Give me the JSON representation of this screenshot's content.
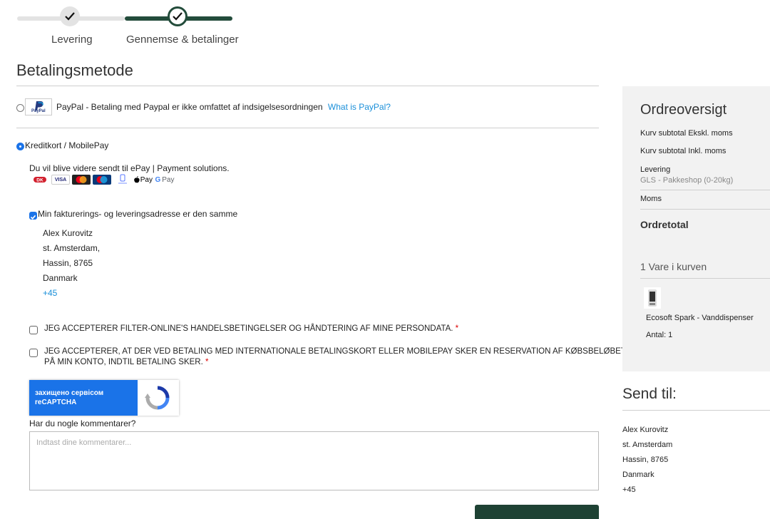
{
  "steps": [
    {
      "label": "Levering",
      "done": true
    },
    {
      "label": "Gennemse & betalinger",
      "done": true,
      "active": true
    }
  ],
  "colors": {
    "accent": "#234c3b",
    "link": "#1a8fd9",
    "checkbox": "#1a73e8"
  },
  "payment": {
    "title": "Betalingsmetode",
    "paypal": {
      "label": "PayPal - Betaling med Paypal er ikke omfattet af indsigelsesordningen",
      "link": "What is PayPal?",
      "logo_text": "PayPal",
      "selected": false
    },
    "card": {
      "label": "Kreditkort / MobilePay",
      "selected": true,
      "info": "Du vil blive videre sendt til ePay | Payment solutions.",
      "icons": [
        "dankort-icon",
        "visa-icon",
        "mastercard-icon",
        "maestro-icon",
        "mobilepay-icon",
        "apple-pay-icon",
        "google-pay-icon"
      ],
      "icon_labels": {
        "visa": "VISA",
        "apple_pay": "Pay",
        "google_pay": "Pay"
      }
    }
  },
  "address": {
    "same_label": "Min fakturerings- og leveringsadresse er den samme",
    "same_checked": true,
    "name": "Alex Kurovitz",
    "street": "st. Amsterdam,",
    "city": "Hassin, 8765",
    "country": "Danmark",
    "phone": "+45"
  },
  "terms": {
    "accept1": "JEG ACCEPTERER FILTER-ONLINE'S HANDELSBETINGELSER OG HÅNDTERING AF MINE PERSONDATA.",
    "accept2_line1": "JEG ACCEPTERER, AT DER VED BETALING MED INTERNATIONALE BETALINGSKORT ELLER MOBILEPAY SKER EN RESERVATION AF KØBSBELØBET",
    "accept2_line2": "PÅ MIN KONTO, INDTIL BETALING SKER.",
    "required_mark": "*"
  },
  "recaptcha": {
    "line1": "захищено сервісом",
    "line2": "reCAPTCHA"
  },
  "comments": {
    "label": "Har du nogle kommentarer?",
    "placeholder": "Indtast dine kommentarer..."
  },
  "summary": {
    "title": "Ordreoversigt",
    "subtotal_excl": "Kurv subtotal Ekskl. moms",
    "subtotal_incl": "Kurv subtotal Inkl. moms",
    "delivery_label": "Levering",
    "delivery_method": "GLS - Pakkeshop (0-20kg)",
    "vat": "Moms",
    "total": "Ordretotal",
    "items_count": "1 Vare i kurven",
    "item_name": "Ecosoft Spark - Vanddispenser",
    "item_qty": "Antal: 1"
  },
  "ship_to": {
    "title": "Send til:",
    "name": "Alex Kurovitz",
    "street": "st. Amsterdam",
    "city": "Hassin, 8765",
    "country": "Danmark",
    "phone": "+45"
  }
}
